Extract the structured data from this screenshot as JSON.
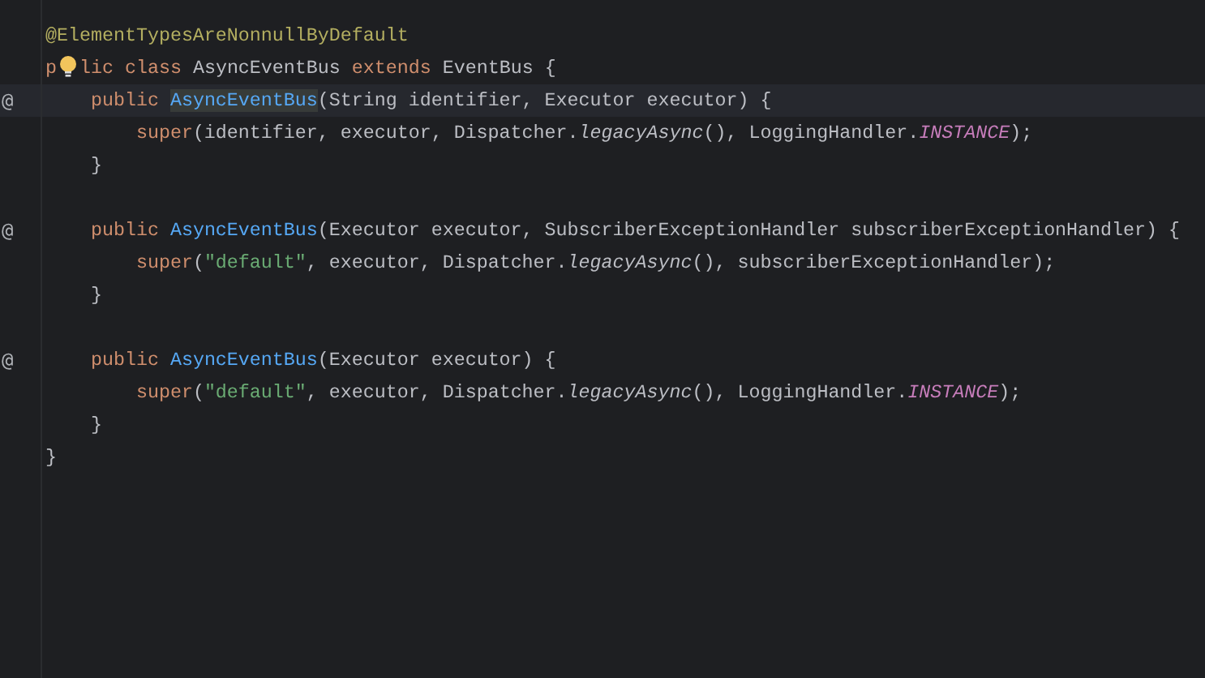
{
  "editor": {
    "lines": [
      {
        "current": false,
        "tokens": [
          {
            "text": "@ElementTypesAreNonnullByDefault",
            "kind": "annotation"
          }
        ]
      },
      {
        "current": false,
        "tokens": [
          {
            "text": "p",
            "kind": "keyword"
          },
          {
            "kind": "bulb"
          },
          {
            "text": "lic class ",
            "kind": "keyword"
          },
          {
            "text": "AsyncEventBus ",
            "kind": "plain"
          },
          {
            "text": "extends ",
            "kind": "keyword"
          },
          {
            "text": "EventBus {",
            "kind": "plain"
          }
        ]
      },
      {
        "current": true,
        "gutter_mark": "@",
        "tokens": [
          {
            "text": "    public ",
            "kind": "keyword"
          },
          {
            "text": "AsyncEventBus",
            "kind": "declaration",
            "highlighted": true
          },
          {
            "text": "(String identifier, Executor executor) {",
            "kind": "plain"
          }
        ]
      },
      {
        "current": false,
        "tokens": [
          {
            "text": "        super",
            "kind": "keyword"
          },
          {
            "text": "(identifier, executor, Dispatcher.",
            "kind": "plain"
          },
          {
            "text": "legacyAsync",
            "kind": "static"
          },
          {
            "text": "(), LoggingHandler.",
            "kind": "plain"
          },
          {
            "text": "INSTANCE",
            "kind": "constant"
          },
          {
            "text": ");",
            "kind": "plain"
          }
        ]
      },
      {
        "current": false,
        "tokens": [
          {
            "text": "    }",
            "kind": "plain"
          }
        ]
      },
      {
        "current": false
      },
      {
        "current": false,
        "gutter_mark": "@",
        "tokens": [
          {
            "text": "    public ",
            "kind": "keyword"
          },
          {
            "text": "AsyncEventBus",
            "kind": "declaration",
            "highlighted": false
          },
          {
            "text": "(Executor executor, SubscriberExceptionHandler subscriberExceptionHandler) {",
            "kind": "plain"
          }
        ]
      },
      {
        "current": false,
        "tokens": [
          {
            "text": "        super",
            "kind": "keyword"
          },
          {
            "text": "(",
            "kind": "plain"
          },
          {
            "text": "\"default\"",
            "kind": "string"
          },
          {
            "text": ", executor, Dispatcher.",
            "kind": "plain"
          },
          {
            "text": "legacyAsync",
            "kind": "static"
          },
          {
            "text": "(), subscriberExceptionHandler);",
            "kind": "plain"
          }
        ]
      },
      {
        "current": false,
        "tokens": [
          {
            "text": "    }",
            "kind": "plain"
          }
        ]
      },
      {
        "current": false
      },
      {
        "current": false,
        "gutter_mark": "@",
        "tokens": [
          {
            "text": "    public ",
            "kind": "keyword"
          },
          {
            "text": "AsyncEventBus",
            "kind": "declaration",
            "highlighted": false
          },
          {
            "text": "(Executor executor) {",
            "kind": "plain"
          }
        ]
      },
      {
        "current": false,
        "tokens": [
          {
            "text": "        super",
            "kind": "keyword"
          },
          {
            "text": "(",
            "kind": "plain"
          },
          {
            "text": "\"default\"",
            "kind": "string"
          },
          {
            "text": ", executor, Dispatcher.",
            "kind": "plain"
          },
          {
            "text": "legacyAsync",
            "kind": "static"
          },
          {
            "text": "(), LoggingHandler.",
            "kind": "plain"
          },
          {
            "text": "INSTANCE",
            "kind": "constant"
          },
          {
            "text": ");",
            "kind": "plain"
          }
        ]
      },
      {
        "current": false,
        "tokens": [
          {
            "text": "    }",
            "kind": "plain"
          }
        ]
      },
      {
        "current": false,
        "tokens": [
          {
            "text": "}",
            "kind": "plain"
          }
        ]
      }
    ]
  }
}
